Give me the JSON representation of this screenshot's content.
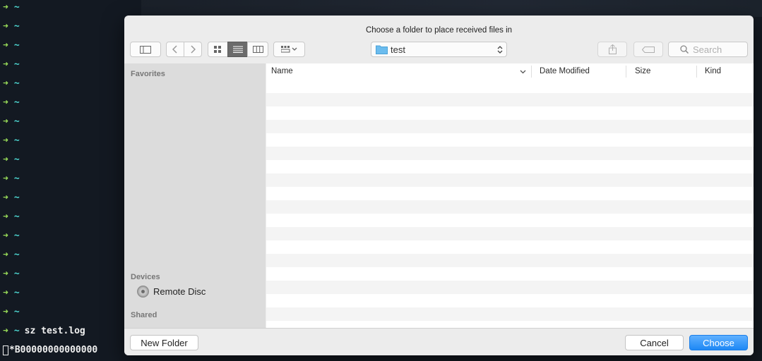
{
  "terminal": {
    "prompt_arrow": "➜",
    "prompt_tilde": "~",
    "empty_prompt_count": 17,
    "last_command": "sz test.log",
    "output_line": "*B00000000000000"
  },
  "dialog": {
    "title": "Choose a folder to place received files in",
    "location": "test",
    "search_placeholder": "Search",
    "columns": [
      "Name",
      "Date Modified",
      "Size",
      "Kind"
    ],
    "sidebar": {
      "favorites": "Favorites",
      "devices": "Devices",
      "device_items": [
        "Remote Disc"
      ],
      "shared": "Shared"
    },
    "buttons": {
      "new_folder": "New Folder",
      "cancel": "Cancel",
      "choose": "Choose"
    }
  },
  "colors": {
    "terminal_bg": "#131922",
    "prompt_arrow": "#9be05a",
    "prompt_tilde": "#4dd6d0",
    "accent": "#1e88f5"
  }
}
